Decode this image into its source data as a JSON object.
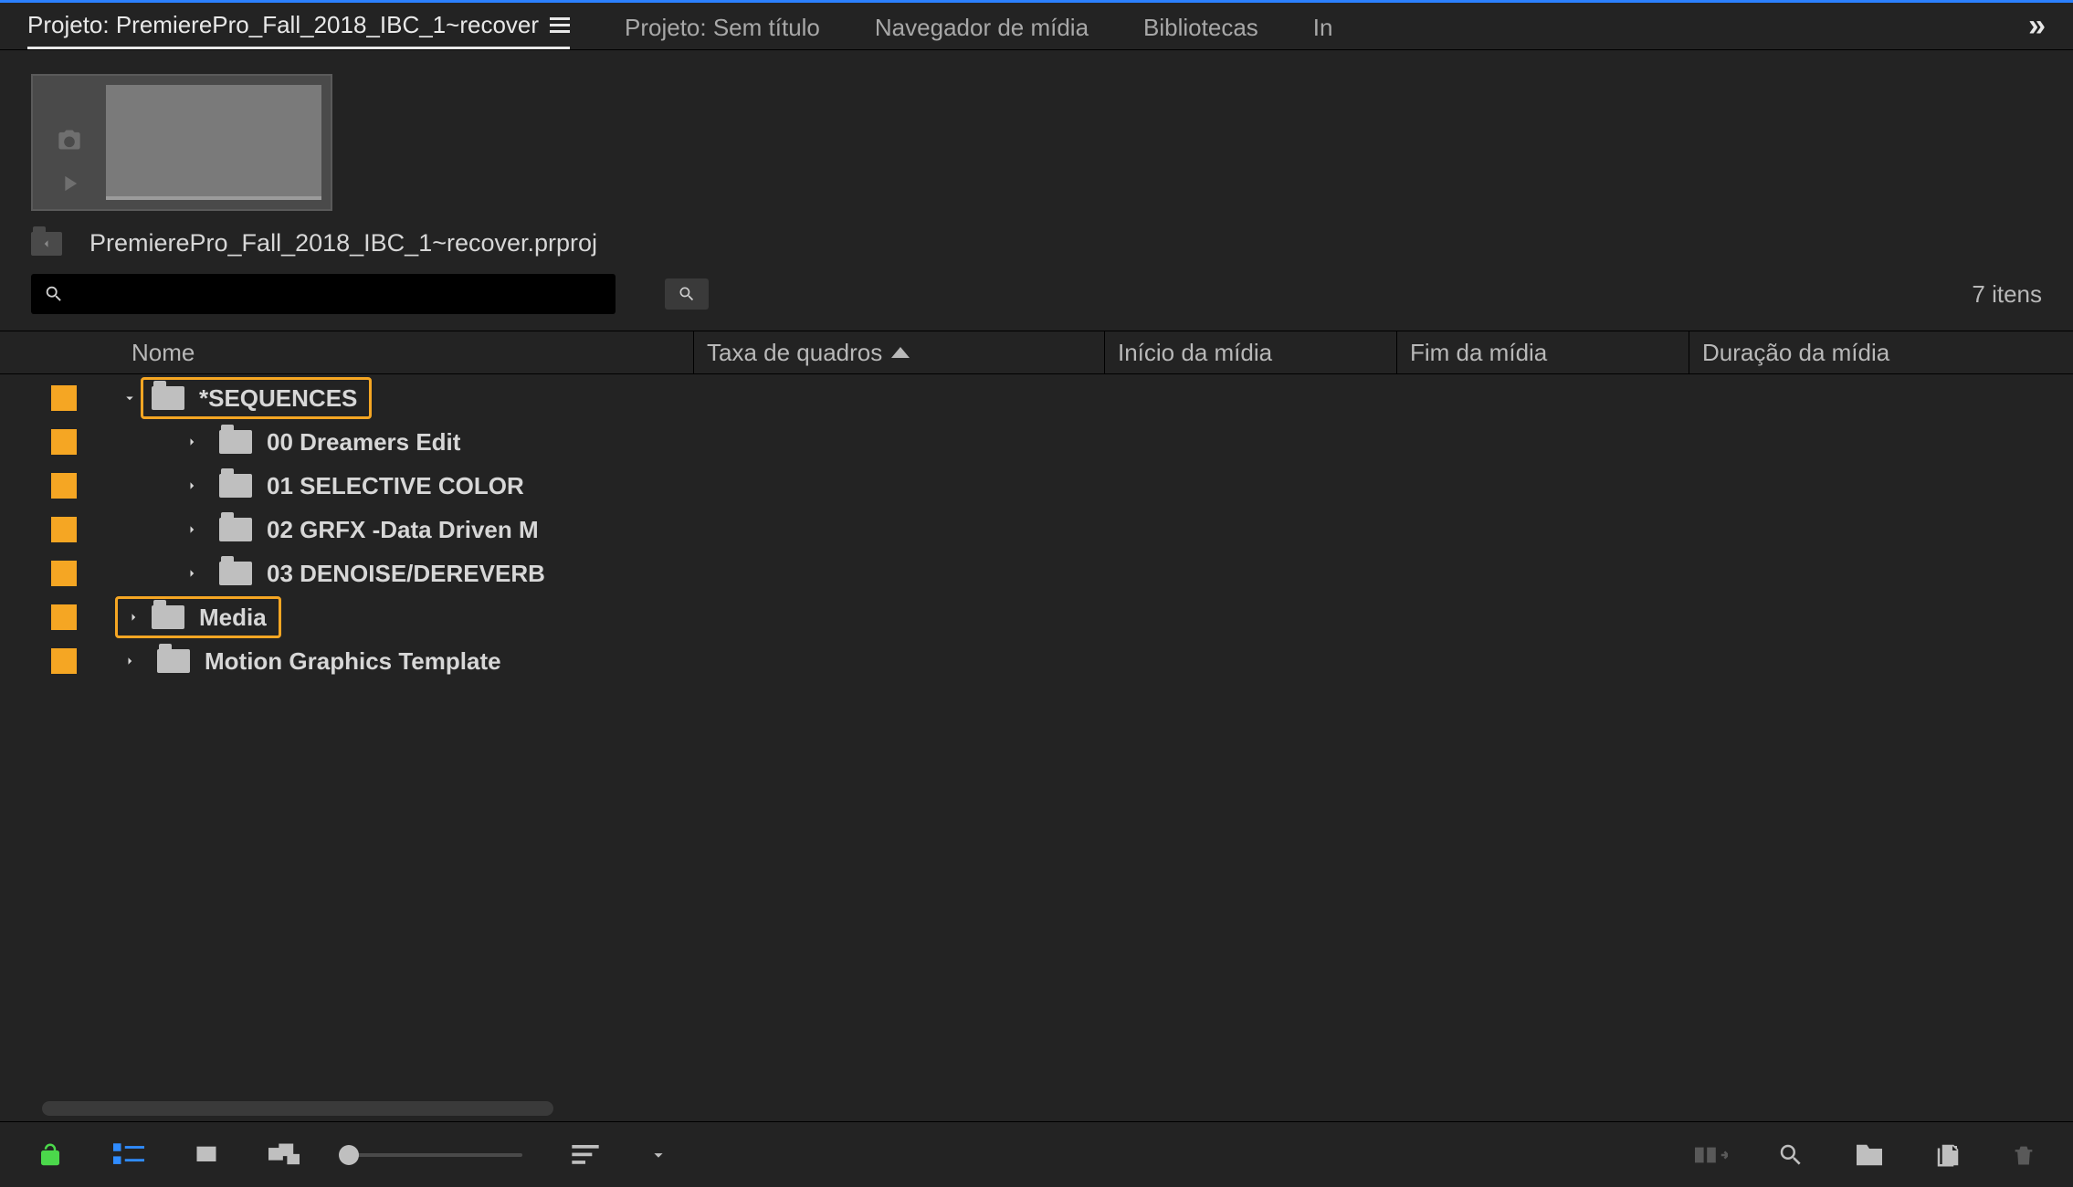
{
  "tabs": {
    "items": [
      {
        "label": "Projeto: PremierePro_Fall_2018_IBC_1~recover",
        "active": true,
        "has_menu": true
      },
      {
        "label": "Projeto: Sem título",
        "active": false
      },
      {
        "label": "Navegador de mídia",
        "active": false
      },
      {
        "label": "Bibliotecas",
        "active": false
      },
      {
        "label": "In",
        "active": false,
        "truncated": true
      }
    ],
    "overflow_glyph": "»"
  },
  "project": {
    "filename": "PremierePro_Fall_2018_IBC_1~recover.prproj"
  },
  "search": {
    "placeholder": "",
    "value": ""
  },
  "item_count": "7 itens",
  "columns": {
    "name": "Nome",
    "frame_rate": "Taxa de quadros",
    "media_start": "Início da mídia",
    "media_end": "Fim da mídia",
    "media_duration": "Duração da mídia",
    "sort_column": "frame_rate",
    "sort_dir": "asc"
  },
  "tree": [
    {
      "depth": 0,
      "expanded": true,
      "label": "*SEQUENCES",
      "highlighted": true
    },
    {
      "depth": 1,
      "expanded": false,
      "label": "00 Dreamers Edit"
    },
    {
      "depth": 1,
      "expanded": false,
      "label": "01 SELECTIVE COLOR"
    },
    {
      "depth": 1,
      "expanded": false,
      "label": "02 GRFX -Data Driven M"
    },
    {
      "depth": 1,
      "expanded": false,
      "label": "03 DENOISE/DEREVERB"
    },
    {
      "depth": 0,
      "expanded": false,
      "label": "Media",
      "highlighted": true
    },
    {
      "depth": 0,
      "expanded": false,
      "label": "Motion Graphics Template"
    }
  ],
  "toolbar_bottom": {
    "left": [
      {
        "id": "lock-icon"
      },
      {
        "id": "list-view-icon"
      },
      {
        "id": "icon-view-icon"
      },
      {
        "id": "freeform-view-icon"
      },
      {
        "id": "zoom-slider"
      },
      {
        "id": "sort-menu-icon"
      },
      {
        "id": "sort-chevron-icon"
      }
    ],
    "right": [
      {
        "id": "automate-icon",
        "disabled": true
      },
      {
        "id": "find-icon"
      },
      {
        "id": "new-bin-icon"
      },
      {
        "id": "new-item-icon"
      },
      {
        "id": "trash-icon",
        "disabled": true
      }
    ]
  }
}
